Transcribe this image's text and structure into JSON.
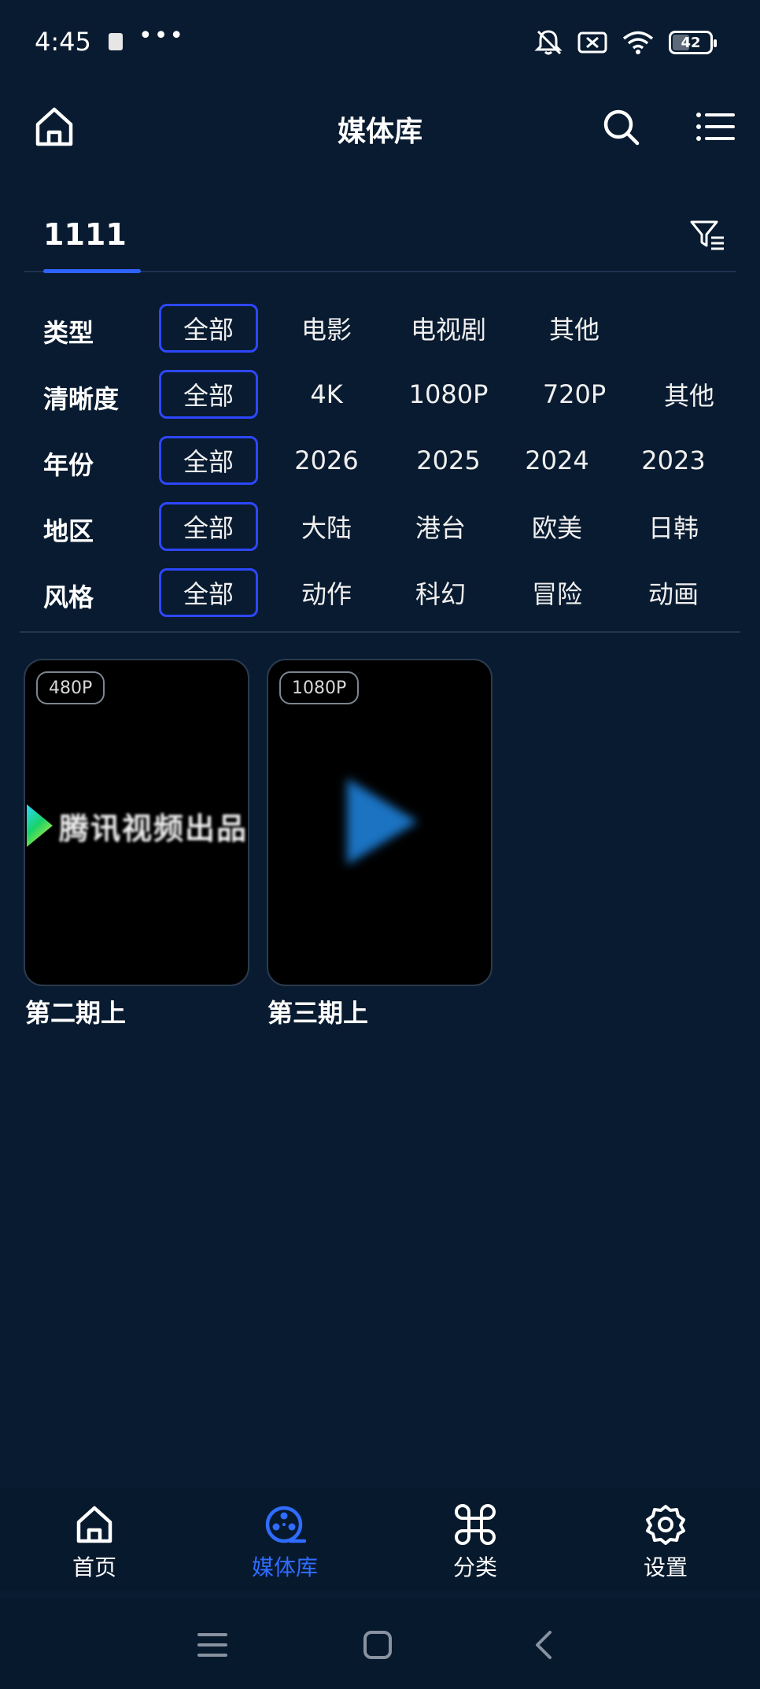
{
  "status_bar": {
    "time": "4:45",
    "more": "•••",
    "battery": "42",
    "icons": [
      "mute-bell-icon",
      "sim-disabled-icon",
      "wifi-icon",
      "battery-icon"
    ]
  },
  "header": {
    "title": "媒体库",
    "left_icon": "home-icon",
    "right_icons": [
      "search-icon",
      "list-icon"
    ]
  },
  "library_tabs": {
    "active": "1111",
    "filter_icon": "filter-list-icon"
  },
  "filters": [
    {
      "label": "类型",
      "options": [
        "全部",
        "电影",
        "电视剧",
        "其他"
      ],
      "selected": 0
    },
    {
      "label": "清晰度",
      "options": [
        "全部",
        "4K",
        "1080P",
        "720P",
        "其他"
      ],
      "selected": 0
    },
    {
      "label": "年份",
      "options": [
        "全部",
        "2026",
        "2025",
        "2024",
        "2023"
      ],
      "selected": 0
    },
    {
      "label": "地区",
      "options": [
        "全部",
        "大陆",
        "港台",
        "欧美",
        "日韩"
      ],
      "selected": 0
    },
    {
      "label": "风格",
      "options": [
        "全部",
        "动作",
        "科幻",
        "冒险",
        "动画"
      ],
      "selected": 0
    }
  ],
  "media_items": [
    {
      "title": "第二期上",
      "quality": "480P",
      "thumb_text": "腾讯视频出品"
    },
    {
      "title": "第三期上",
      "quality": "1080P"
    }
  ],
  "bottom_nav": {
    "items": [
      {
        "label": "首页",
        "icon": "home-icon"
      },
      {
        "label": "媒体库",
        "icon": "film-reel-icon",
        "active": true
      },
      {
        "label": "分类",
        "icon": "command-icon"
      },
      {
        "label": "设置",
        "icon": "gear-icon"
      }
    ],
    "accent": "#2f6cff"
  },
  "colors": {
    "background": "#091b30",
    "accent": "#2d47ff"
  }
}
